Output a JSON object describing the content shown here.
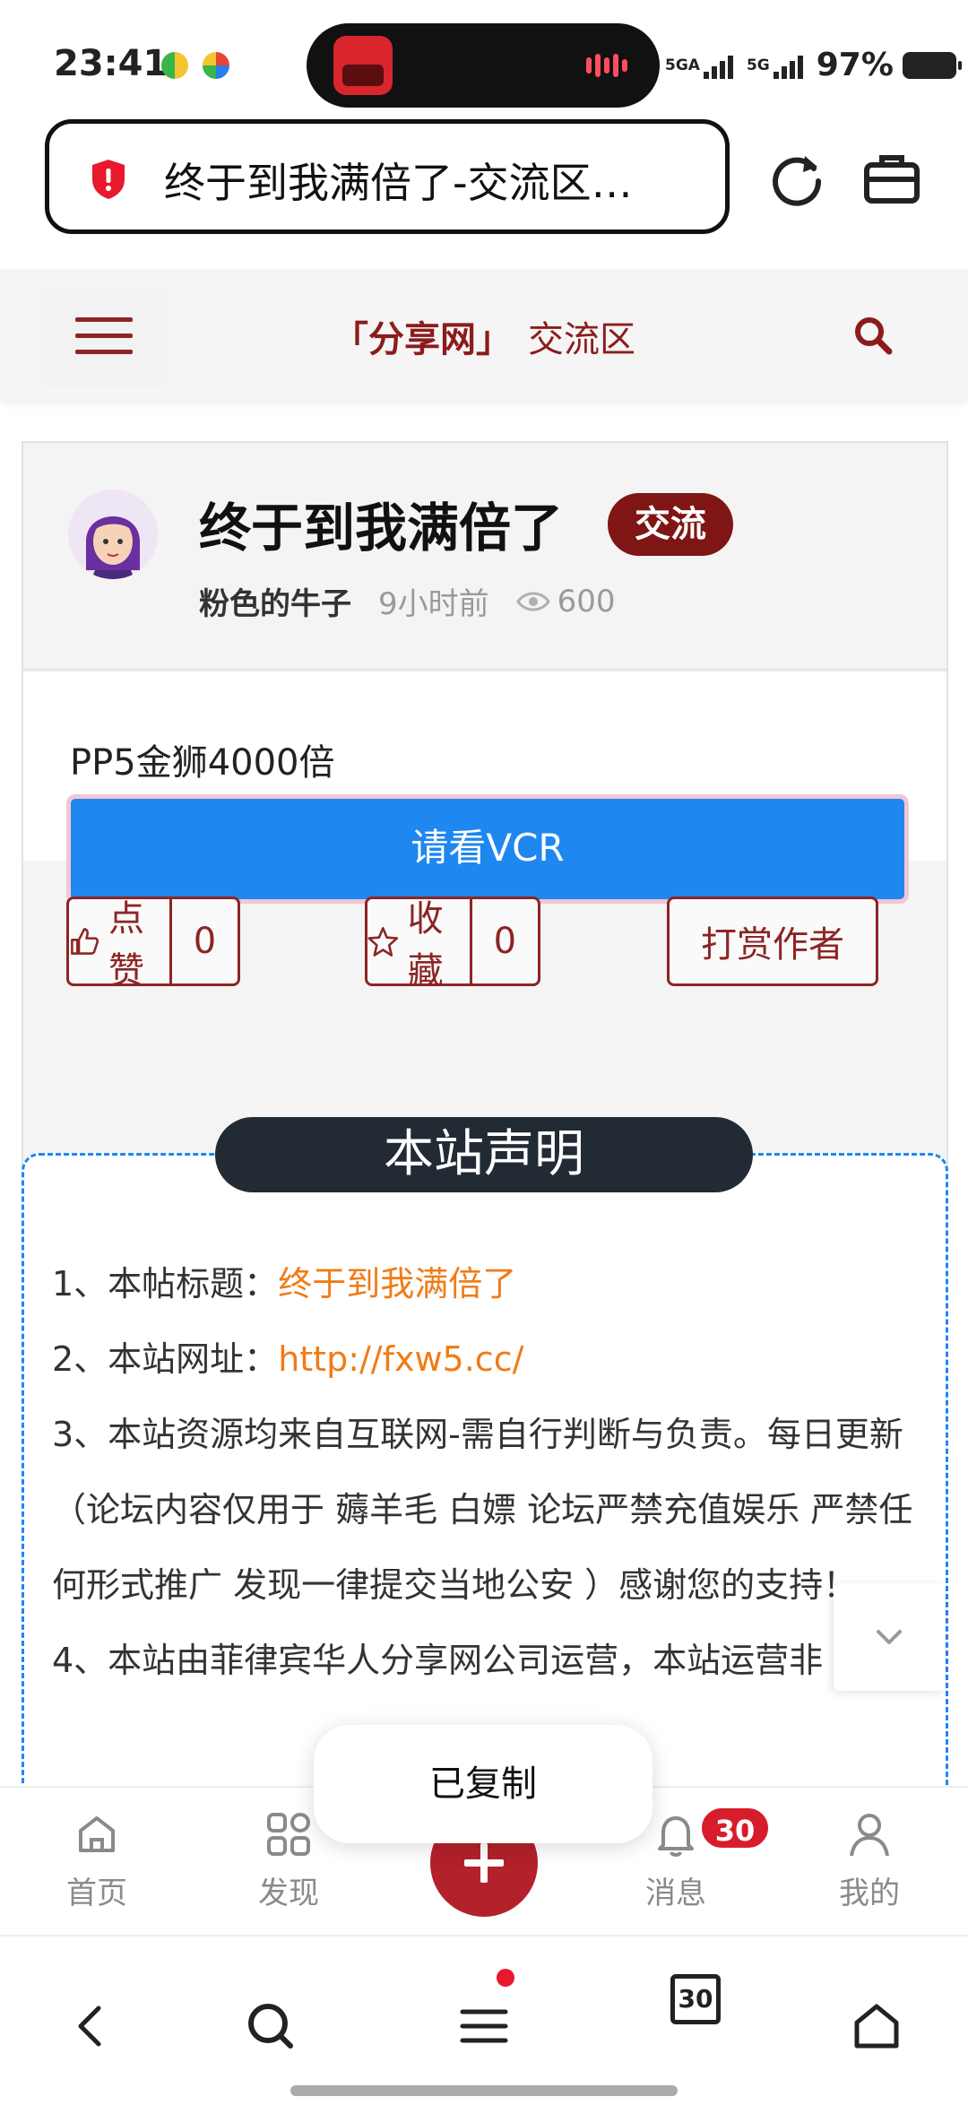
{
  "status_bar": {
    "time": "23:41",
    "network_label_1": "5GA",
    "network_label_2": "5G",
    "battery": "97%"
  },
  "browser": {
    "page_title": "终于到我满倍了-交流区…",
    "tabs_count": "30"
  },
  "site_header": {
    "brand": "「分享网」",
    "section": "交流区"
  },
  "post": {
    "title": "终于到我满倍了",
    "tag": "交流",
    "author": "粉色的牛子",
    "time": "9小时前",
    "views": "600",
    "body_text": "PP5金狮4000倍",
    "vcr_button": "请看VCR"
  },
  "actions": {
    "like_label": "点赞",
    "like_count": "0",
    "favorite_label": "收藏",
    "favorite_count": "0",
    "tip_label": "打赏作者"
  },
  "notice": {
    "title": "本站声明",
    "line1_label": "1、本帖标题：",
    "line1_value": "终于到我满倍了",
    "line2_label": "2、本站网址：",
    "line2_value": "http://fxw5.cc/",
    "line3": "3、本站资源均来自互联网-需自行判断与负责。每日更新（论坛内容仅用于 薅羊毛 白嫖 论坛严禁充值娱乐 严禁任何形式推广 发现一律提交当地公安 ）感谢您的支持！",
    "line4": "4、本站由菲律宾华人分享网公司运营，本站运营非"
  },
  "tabbar": {
    "home": "首页",
    "discover": "发现",
    "messages": "消息",
    "messages_badge": "30",
    "mine": "我的"
  },
  "toast": "已复制",
  "colors": {
    "brand": "#8c1c1c",
    "tag_bg": "#7f1515",
    "vcr_button": "#1e87f0",
    "notice_value": "#f07c16",
    "badge": "#d71d2c"
  }
}
